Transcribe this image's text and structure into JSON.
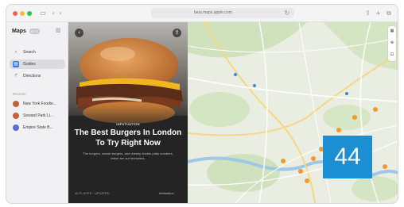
{
  "window": {
    "url": "beta.maps.apple.com"
  },
  "sidebar": {
    "brand": "Maps",
    "beta_tag": "BETA",
    "items": [
      {
        "label": "Search",
        "icon": "search-icon",
        "active": false
      },
      {
        "label": "Guides",
        "icon": "guides-icon",
        "active": true
      },
      {
        "label": "Directions",
        "icon": "directions-icon",
        "active": false
      }
    ],
    "section_label": "Recents",
    "recents": [
      {
        "label": "New York Foodie...",
        "icon": "guide-icon",
        "color": "#c1623f"
      },
      {
        "label": "Seward Park Li...",
        "icon": "guide-icon",
        "color": "#c1623f"
      },
      {
        "label": "Empire State B...",
        "icon": "landmark-icon",
        "color": "#5e6ad2"
      }
    ]
  },
  "guide": {
    "eyebrow": "INFATUATION",
    "title": "The Best Burgers In London To Try Right Now",
    "description": "The burgers, smash burgers, and cheeky double patty numbers, these are our favourites.",
    "footer": "46 PLACES · UPDATED",
    "source": "Infatuation"
  },
  "map": {
    "cluster_count": "44",
    "accent": "#1c8fd3",
    "poi_color": "#f39a2b",
    "controls": [
      "map-mode-icon",
      "compass-icon",
      "zoom-icon"
    ]
  },
  "colors": {
    "sidebar_active": "#dcdce0",
    "selected_icon": "#3478f6"
  }
}
